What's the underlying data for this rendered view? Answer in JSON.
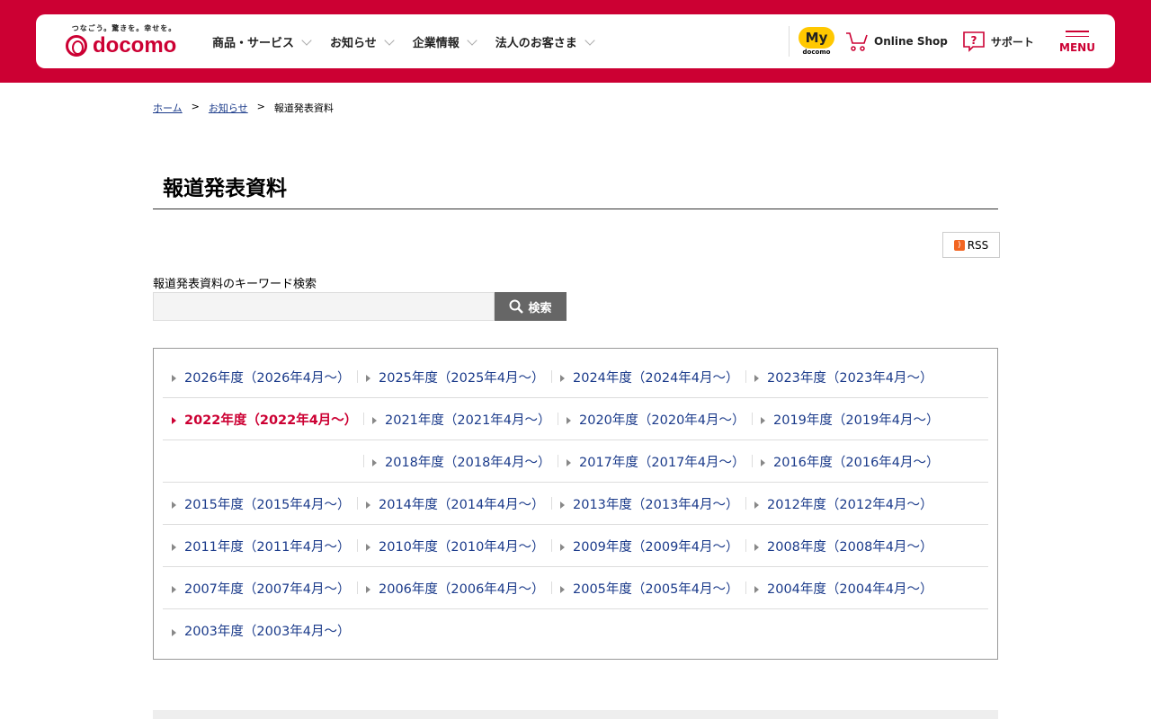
{
  "header": {
    "tagline": "つなごう。驚きを。幸せを。",
    "logo": "docomo",
    "nav": [
      "商品・サービス",
      "お知らせ",
      "企業情報",
      "法人のお客さま"
    ],
    "my": "My",
    "my_sub": "docomo",
    "online_shop": "Online Shop",
    "support": "サポート",
    "menu": "MENU"
  },
  "breadcrumb": [
    "ホーム",
    "お知らせ",
    "報道発表資料"
  ],
  "page_title": "報道発表資料",
  "rss": "RSS",
  "search": {
    "label": "報道発表資料のキーワード検索",
    "value": "",
    "button": "検索"
  },
  "years": [
    [
      "2026年度（2026年4月～）",
      "2025年度（2025年4月～）",
      "2024年度（2024年4月～）",
      "2023年度（2023年4月～）"
    ],
    [
      "2022年度（2022年4月～）",
      "2021年度（2021年4月～）",
      "2020年度（2020年4月～）",
      "2019年度（2019年4月～）"
    ],
    [
      "",
      "2018年度（2018年4月～）",
      "2017年度（2017年4月～）",
      "2016年度（2016年4月～）"
    ],
    [
      "2015年度（2015年4月～）",
      "2014年度（2014年4月～）",
      "2013年度（2013年4月～）",
      "2012年度（2012年4月～）"
    ],
    [
      "2011年度（2011年4月～）",
      "2010年度（2010年4月～）",
      "2009年度（2009年4月～）",
      "2008年度（2008年4月～）"
    ],
    [
      "2007年度（2007年4月～）",
      "2006年度（2006年4月～）",
      "2005年度（2005年4月～）",
      "2004年度（2004年4月～）"
    ],
    [
      "2003年度（2003年4月～）"
    ]
  ],
  "active_year": "2022年度（2022年4月～）",
  "colors": {
    "brand": "#cc0033",
    "link": "#1a3a8a"
  }
}
